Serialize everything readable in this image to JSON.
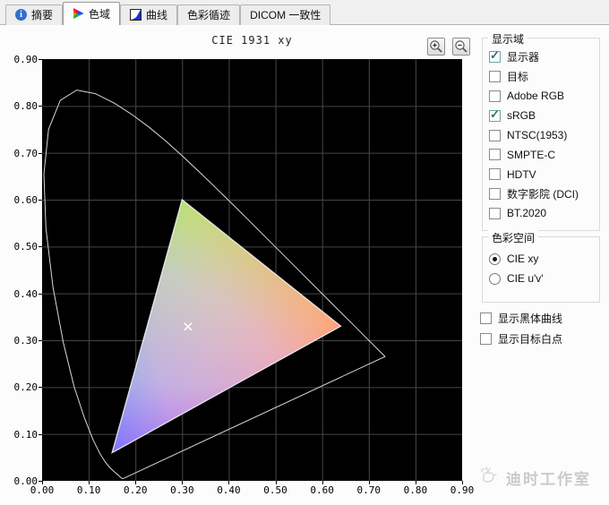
{
  "tabs": {
    "items": [
      {
        "name": "tab-summary",
        "label": "摘要",
        "icon": "info-icon",
        "active": false
      },
      {
        "name": "tab-gamut",
        "label": "色域",
        "icon": "gamut-icon",
        "active": true
      },
      {
        "name": "tab-curves",
        "label": "曲线",
        "icon": "curve-icon",
        "active": false
      },
      {
        "name": "tab-color-tracking",
        "label": "色彩循迹",
        "icon": null,
        "active": false
      },
      {
        "name": "tab-dicom",
        "label": "DICOM 一致性",
        "icon": null,
        "active": false
      }
    ]
  },
  "chart": {
    "title": "CIE 1931 xy"
  },
  "chart_data": {
    "type": "chromaticity_diagram",
    "title": "CIE 1931 xy",
    "xlim": [
      0,
      0.9
    ],
    "ylim": [
      0,
      0.9
    ],
    "grid": true,
    "plot_background": "#000000",
    "x_tick_labels": [
      "0.00",
      "0.10",
      "0.20",
      "0.30",
      "0.40",
      "0.50",
      "0.60",
      "0.70",
      "0.80",
      "0.90"
    ],
    "y_tick_labels": [
      "0.00",
      "0.10",
      "0.20",
      "0.30",
      "0.40",
      "0.50",
      "0.60",
      "0.70",
      "0.80",
      "0.90"
    ],
    "spectral_locus": [
      [
        0.1741,
        0.005
      ],
      [
        0.1721,
        0.0048
      ],
      [
        0.1703,
        0.0058
      ],
      [
        0.1669,
        0.0086
      ],
      [
        0.1644,
        0.0109
      ],
      [
        0.1611,
        0.0138
      ],
      [
        0.1566,
        0.0177
      ],
      [
        0.151,
        0.0227
      ],
      [
        0.144,
        0.0297
      ],
      [
        0.1355,
        0.0399
      ],
      [
        0.1241,
        0.0578
      ],
      [
        0.1096,
        0.0868
      ],
      [
        0.0913,
        0.1327
      ],
      [
        0.0687,
        0.2007
      ],
      [
        0.0454,
        0.295
      ],
      [
        0.0235,
        0.4127
      ],
      [
        0.0082,
        0.5384
      ],
      [
        0.0039,
        0.6548
      ],
      [
        0.0139,
        0.7502
      ],
      [
        0.0389,
        0.812
      ],
      [
        0.0743,
        0.8338
      ],
      [
        0.1142,
        0.8262
      ],
      [
        0.1547,
        0.8059
      ],
      [
        0.1929,
        0.7816
      ],
      [
        0.2296,
        0.7543
      ],
      [
        0.2658,
        0.7243
      ],
      [
        0.3016,
        0.6923
      ],
      [
        0.3373,
        0.6589
      ],
      [
        0.3731,
        0.6245
      ],
      [
        0.4087,
        0.5896
      ],
      [
        0.4441,
        0.5547
      ],
      [
        0.4788,
        0.5202
      ],
      [
        0.5125,
        0.4866
      ],
      [
        0.5448,
        0.4544
      ],
      [
        0.5752,
        0.4242
      ],
      [
        0.6029,
        0.3965
      ],
      [
        0.627,
        0.3725
      ],
      [
        0.6482,
        0.3514
      ],
      [
        0.6658,
        0.334
      ],
      [
        0.6915,
        0.3083
      ],
      [
        0.7079,
        0.292
      ],
      [
        0.719,
        0.2809
      ],
      [
        0.726,
        0.274
      ],
      [
        0.7347,
        0.2653
      ]
    ],
    "gamut_triangle": {
      "name": "sRGB / 显示器",
      "red": [
        0.64,
        0.33
      ],
      "green": [
        0.3,
        0.6
      ],
      "blue": [
        0.15,
        0.06
      ]
    },
    "white_point": {
      "x": 0.3127,
      "y": 0.329,
      "marker": "x"
    }
  },
  "side_panel": {
    "display_gamuts": {
      "legend": "显示域",
      "items": [
        {
          "name": "checkbox-monitor",
          "label": "显示器",
          "checked": true
        },
        {
          "name": "checkbox-target",
          "label": "目标",
          "checked": false
        },
        {
          "name": "checkbox-adobe-rgb",
          "label": "Adobe RGB",
          "checked": false
        },
        {
          "name": "checkbox-srgb",
          "label": "sRGB",
          "checked": true
        },
        {
          "name": "checkbox-ntsc-1953",
          "label": "NTSC(1953)",
          "checked": false
        },
        {
          "name": "checkbox-smpte-c",
          "label": "SMPTE-C",
          "checked": false
        },
        {
          "name": "checkbox-hdtv",
          "label": "HDTV",
          "checked": false
        },
        {
          "name": "checkbox-dci",
          "label": "数字影院 (DCI)",
          "checked": false
        },
        {
          "name": "checkbox-bt2020",
          "label": "BT.2020",
          "checked": false
        }
      ]
    },
    "color_space": {
      "legend": "色彩空间",
      "options": [
        {
          "name": "radio-cie-xy",
          "label": "CIE xy",
          "selected": true
        },
        {
          "name": "radio-cie-uv",
          "label": "CIE u'v'",
          "selected": false
        }
      ]
    },
    "extra_options": [
      {
        "name": "checkbox-show-blackbody-curve",
        "label": "显示黑体曲线",
        "checked": false
      },
      {
        "name": "checkbox-show-target-white-point",
        "label": "显示目标白点",
        "checked": false
      }
    ]
  },
  "watermark": {
    "text": "迪时工作室"
  },
  "colors": {
    "check_accent": "#2e6f6f",
    "grid_line": "#474747",
    "locus_line": "#d9d9d9",
    "triangle_red": "#ff0000",
    "triangle_green": "#00e000",
    "triangle_blue": "#1414ff"
  }
}
